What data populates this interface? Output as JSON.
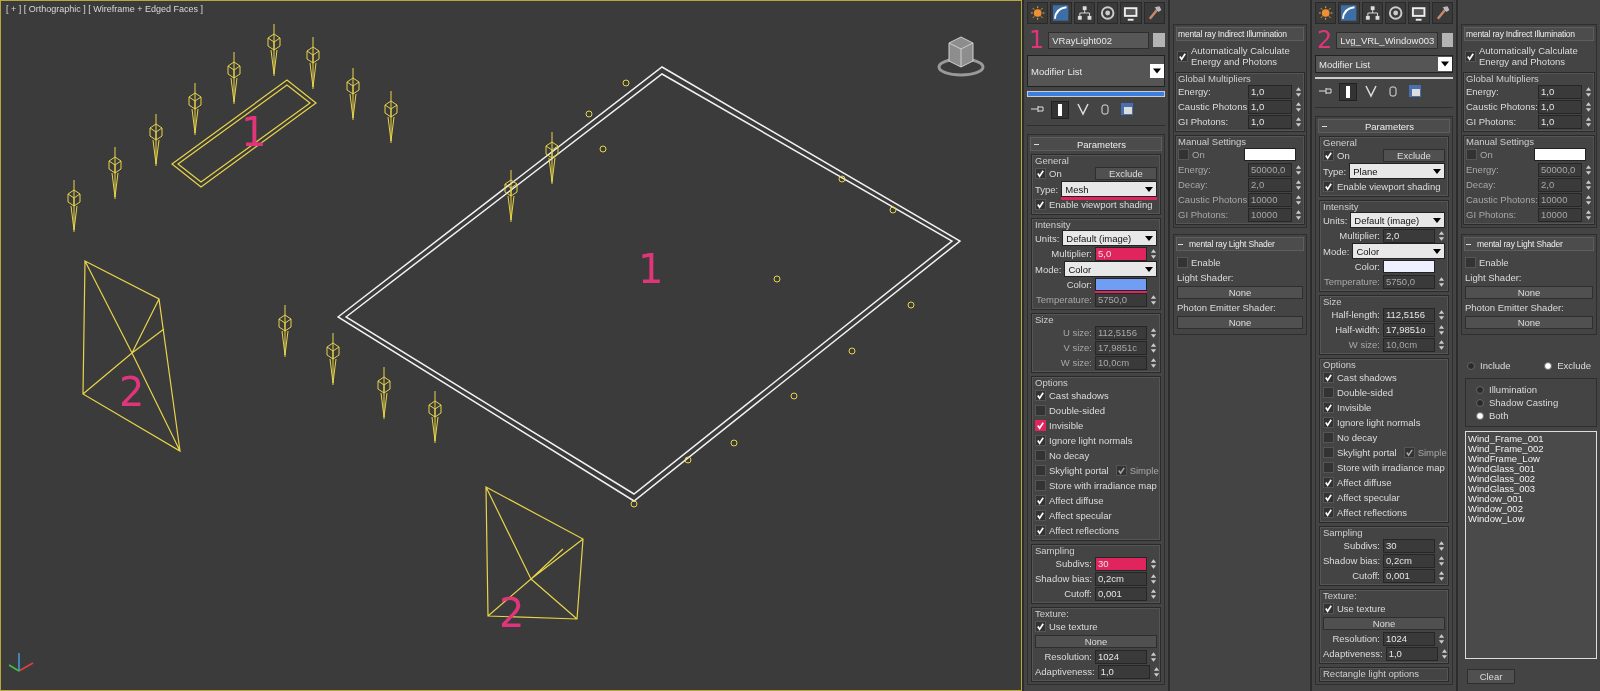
{
  "viewport": {
    "label": "[ + ] [ Orthographic ] [ Wireframe + Edged Faces ]",
    "annotations": [
      "1",
      "1",
      "2",
      "2"
    ]
  },
  "panels": [
    {
      "kind": "light",
      "header": {
        "marker": "1",
        "name": "VRayLight002",
        "modifier": "Modifier List"
      },
      "rollouts": [
        {
          "title": "Parameters",
          "collapsible": true,
          "groups": [
            {
              "title": "General",
              "rows": [
                {
                  "kind": "check_button",
                  "label": "On",
                  "checked": true,
                  "button": "Exclude"
                },
                {
                  "kind": "dropdown",
                  "label": "Type:",
                  "value": "Mesh",
                  "underlined": true
                },
                {
                  "kind": "check",
                  "label": "Enable viewport shading",
                  "checked": true
                }
              ]
            },
            {
              "title": "Intensity",
              "rows": [
                {
                  "kind": "dropdown",
                  "label": "Units:",
                  "value": "Default (image)"
                },
                {
                  "kind": "field",
                  "label": "Multiplier:",
                  "value": "5,0",
                  "highlighted": true
                },
                {
                  "kind": "dropdown",
                  "label": "Mode:",
                  "value": "Color"
                },
                {
                  "kind": "color",
                  "label": "Color:",
                  "color": "#6f9ef2",
                  "underlined": true
                },
                {
                  "kind": "field",
                  "label": "Temperature:",
                  "value": "5750,0",
                  "disabled": true
                }
              ]
            },
            {
              "title": "Size",
              "rows": [
                {
                  "kind": "field",
                  "label": "U size:",
                  "value": "112,5156",
                  "disabled": true
                },
                {
                  "kind": "field",
                  "label": "V size:",
                  "value": "17,9851c",
                  "disabled": true
                },
                {
                  "kind": "field",
                  "label": "W size:",
                  "value": "10,0cm",
                  "disabled": true
                }
              ]
            },
            {
              "title": "Options",
              "rows": [
                {
                  "kind": "check",
                  "label": "Cast shadows",
                  "checked": true
                },
                {
                  "kind": "check",
                  "label": "Double-sided",
                  "checked": false
                },
                {
                  "kind": "check",
                  "label": "Invisible",
                  "checked": true,
                  "highlighted": true
                },
                {
                  "kind": "check",
                  "label": "Ignore light normals",
                  "checked": true
                },
                {
                  "kind": "check",
                  "label": "No decay",
                  "checked": false
                },
                {
                  "kind": "check_pair",
                  "label": "Skylight portal",
                  "checked": false,
                  "extra": "Simple",
                  "extra_checked": true
                },
                {
                  "kind": "check",
                  "label": "Store with irradiance map",
                  "checked": false
                },
                {
                  "kind": "check",
                  "label": "Affect diffuse",
                  "checked": true
                },
                {
                  "kind": "check",
                  "label": "Affect specular",
                  "checked": true
                },
                {
                  "kind": "check",
                  "label": "Affect reflections",
                  "checked": true
                }
              ]
            },
            {
              "title": "Sampling",
              "rows": [
                {
                  "kind": "field",
                  "label": "Subdivs:",
                  "value": "30",
                  "highlighted": true
                },
                {
                  "kind": "field",
                  "label": "Shadow bias:",
                  "value": "0,2cm"
                },
                {
                  "kind": "field",
                  "label": "Cutoff:",
                  "value": "0,001"
                }
              ]
            },
            {
              "title": "Texture:",
              "rows": [
                {
                  "kind": "check",
                  "label": "Use texture",
                  "checked": true
                },
                {
                  "kind": "button",
                  "value": "None"
                },
                {
                  "kind": "field",
                  "label": "Resolution:",
                  "value": "1024"
                },
                {
                  "kind": "field",
                  "label": "Adaptiveness:",
                  "value": "1,0"
                }
              ]
            }
          ]
        }
      ]
    },
    {
      "kind": "mental_ray",
      "rollouts": [
        {
          "title": "mental ray Indirect Illumination",
          "collapsible": false,
          "groups": [
            {
              "rows": [
                {
                  "kind": "check",
                  "label": "Automatically Calculate Energy and Photons",
                  "checked": true
                }
              ]
            },
            {
              "title": "Global Multipliers",
              "rows": [
                {
                  "kind": "field",
                  "label": "Energy:",
                  "value": "1,0"
                },
                {
                  "kind": "field",
                  "label": "Caustic Photons:",
                  "value": "1,0"
                },
                {
                  "kind": "field",
                  "label": "GI Photons:",
                  "value": "1,0"
                }
              ]
            },
            {
              "title": "Manual Settings",
              "rows": [
                {
                  "kind": "check_color",
                  "label": "On",
                  "checked": false,
                  "color": "#ffffff"
                },
                {
                  "kind": "field",
                  "label": "Energy:",
                  "value": "50000,0",
                  "disabled": true
                },
                {
                  "kind": "field",
                  "label": "Decay:",
                  "value": "2,0",
                  "disabled": true
                },
                {
                  "kind": "field",
                  "label": "Caustic Photons:",
                  "value": "10000",
                  "disabled": true
                },
                {
                  "kind": "field",
                  "label": "GI Photons:",
                  "value": "10000",
                  "disabled": true
                }
              ]
            }
          ]
        },
        {
          "title": "mental ray Light Shader",
          "collapsible": true,
          "groups": [
            {
              "rows": [
                {
                  "kind": "check",
                  "label": "Enable",
                  "checked": false
                },
                {
                  "kind": "label",
                  "label": "Light Shader:"
                },
                {
                  "kind": "button",
                  "value": "None"
                },
                {
                  "kind": "label",
                  "label": "Photon Emitter Shader:"
                },
                {
                  "kind": "button",
                  "value": "None"
                }
              ]
            }
          ]
        }
      ]
    },
    {
      "kind": "light",
      "header": {
        "marker": "2",
        "name": "Lvg_VRL_Window003",
        "modifier": "Modifier List"
      },
      "rollouts": [
        {
          "title": "Parameters",
          "collapsible": true,
          "groups": [
            {
              "title": "General",
              "rows": [
                {
                  "kind": "check_button",
                  "label": "On",
                  "checked": true,
                  "button": "Exclude"
                },
                {
                  "kind": "dropdown",
                  "label": "Type:",
                  "value": "Plane"
                },
                {
                  "kind": "check",
                  "label": "Enable viewport shading",
                  "checked": true
                }
              ]
            },
            {
              "title": "Intensity",
              "rows": [
                {
                  "kind": "dropdown",
                  "label": "Units:",
                  "value": "Default (image)"
                },
                {
                  "kind": "field",
                  "label": "Multiplier:",
                  "value": "2,0"
                },
                {
                  "kind": "dropdown",
                  "label": "Mode:",
                  "value": "Color"
                },
                {
                  "kind": "color",
                  "label": "Color:",
                  "color": "#eef0ff"
                },
                {
                  "kind": "field",
                  "label": "Temperature:",
                  "value": "5750,0",
                  "disabled": true
                }
              ]
            },
            {
              "title": "Size",
              "rows": [
                {
                  "kind": "field",
                  "label": "Half-length:",
                  "value": "112,5156"
                },
                {
                  "kind": "field",
                  "label": "Half-width:",
                  "value": "17,9851o"
                },
                {
                  "kind": "field",
                  "label": "W size:",
                  "value": "10,0cm",
                  "disabled": true
                }
              ]
            },
            {
              "title": "Options",
              "rows": [
                {
                  "kind": "check",
                  "label": "Cast shadows",
                  "checked": true
                },
                {
                  "kind": "check",
                  "label": "Double-sided",
                  "checked": false
                },
                {
                  "kind": "check",
                  "label": "Invisible",
                  "checked": true
                },
                {
                  "kind": "check",
                  "label": "Ignore light normals",
                  "checked": true
                },
                {
                  "kind": "check",
                  "label": "No decay",
                  "checked": false
                },
                {
                  "kind": "check_pair",
                  "label": "Skylight portal",
                  "checked": false,
                  "extra": "Simple",
                  "extra_checked": true
                },
                {
                  "kind": "check",
                  "label": "Store with irradiance map",
                  "checked": false
                },
                {
                  "kind": "check",
                  "label": "Affect diffuse",
                  "checked": true
                },
                {
                  "kind": "check",
                  "label": "Affect specular",
                  "checked": true
                },
                {
                  "kind": "check",
                  "label": "Affect reflections",
                  "checked": true
                }
              ]
            },
            {
              "title": "Sampling",
              "rows": [
                {
                  "kind": "field",
                  "label": "Subdivs:",
                  "value": "30"
                },
                {
                  "kind": "field",
                  "label": "Shadow bias:",
                  "value": "0,2cm"
                },
                {
                  "kind": "field",
                  "label": "Cutoff:",
                  "value": "0,001"
                }
              ]
            },
            {
              "title": "Texture:",
              "rows": [
                {
                  "kind": "check",
                  "label": "Use texture",
                  "checked": true
                },
                {
                  "kind": "button",
                  "value": "None"
                },
                {
                  "kind": "field",
                  "label": "Resolution:",
                  "value": "1024"
                },
                {
                  "kind": "field",
                  "label": "Adaptiveness:",
                  "value": "1,0"
                }
              ]
            },
            {
              "title": "Rectangle light options"
            }
          ]
        }
      ]
    },
    {
      "kind": "mental_ray",
      "rollouts": [
        {
          "title": "mental ray Indirect Illumination",
          "collapsible": false,
          "groups": [
            {
              "rows": [
                {
                  "kind": "check",
                  "label": "Automatically Calculate Energy and Photons",
                  "checked": true
                }
              ]
            },
            {
              "title": "Global Multipliers",
              "rows": [
                {
                  "kind": "field",
                  "label": "Energy:",
                  "value": "1,0"
                },
                {
                  "kind": "field",
                  "label": "Caustic Photons:",
                  "value": "1,0"
                },
                {
                  "kind": "field",
                  "label": "GI Photons:",
                  "value": "1,0"
                }
              ]
            },
            {
              "title": "Manual Settings",
              "rows": [
                {
                  "kind": "check_color",
                  "label": "On",
                  "checked": false,
                  "color": "#ffffff"
                },
                {
                  "kind": "field",
                  "label": "Energy:",
                  "value": "50000,0",
                  "disabled": true
                },
                {
                  "kind": "field",
                  "label": "Decay:",
                  "value": "2,0",
                  "disabled": true
                },
                {
                  "kind": "field",
                  "label": "Caustic Photons:",
                  "value": "10000",
                  "disabled": true
                },
                {
                  "kind": "field",
                  "label": "GI Photons:",
                  "value": "10000",
                  "disabled": true
                }
              ]
            }
          ]
        },
        {
          "title": "mental ray Light Shader",
          "collapsible": true,
          "groups": [
            {
              "rows": [
                {
                  "kind": "check",
                  "label": "Enable",
                  "checked": false
                },
                {
                  "kind": "label",
                  "label": "Light Shader:"
                },
                {
                  "kind": "button",
                  "value": "None"
                },
                {
                  "kind": "label",
                  "label": "Photon Emitter Shader:"
                },
                {
                  "kind": "button",
                  "value": "None"
                }
              ]
            }
          ]
        }
      ],
      "exclude": {
        "modes": [
          {
            "label": "Include",
            "selected": false
          },
          {
            "label": "Exclude",
            "selected": true
          }
        ],
        "types": [
          {
            "label": "Illumination",
            "selected": false
          },
          {
            "label": "Shadow Casting",
            "selected": false
          },
          {
            "label": "Both",
            "selected": true
          }
        ],
        "objects": [
          "Wind_Frame_001",
          "Wind_Frame_002",
          "WindFrame_Low",
          "WindGlass_001",
          "WindGlass_002",
          "WindGlass_003",
          "Window_001",
          "Window_002",
          "Window_Low"
        ],
        "button": "Clear"
      }
    }
  ]
}
